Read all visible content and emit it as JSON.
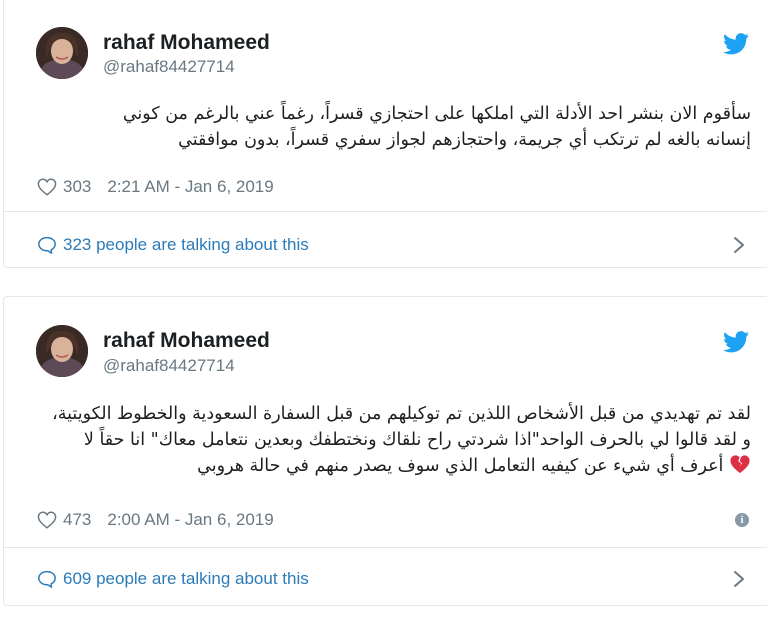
{
  "tweets": [
    {
      "user": {
        "name": "rahaf Mohameed",
        "handle": "@rahaf84427714"
      },
      "text_lines": [
        "سأقوم الان بنشر احد الأدلة التي املكها على احتجازي قسراً، رغماً عني بالرغم من كوني",
        "إنسانه بالغه لم ترتكب أي جريمة، واحتجازهم لجواز سفري قسراً، بدون موافقتي"
      ],
      "likes": "303",
      "timestamp": "2:21 AM - Jan 6, 2019",
      "talking": "323 people are talking about this"
    },
    {
      "user": {
        "name": "rahaf Mohameed",
        "handle": "@rahaf84427714"
      },
      "text_lines": [
        "لقد تم تهديدي من قبل الأشخاص اللذين تم توكيلهم من قبل السفارة السعودية والخطوط الكويتية،",
        "و لقد قالوا لي بالحرف الواحد\"اذا شردتي راح نلقاك ونختطفك وبعدين نتعامل معاك\" انا حقاً لا",
        "أعرف أي شيء عن كيفيه التعامل الذي سوف يصدر منهم في حالة هروبي"
      ],
      "likes": "473",
      "timestamp": "2:00 AM - Jan 6, 2019",
      "talking": "609 people are talking about this"
    }
  ],
  "icons": {
    "twitter": "twitter-bird-icon",
    "like": "heart-outline-icon",
    "reply": "speech-bubble-icon",
    "more": "chevron-right-icon",
    "info": "info-icon",
    "emoji": "broken-heart-icon"
  },
  "colors": {
    "twitter_blue": "#1da1f2",
    "link_blue": "#2b7bb9",
    "muted": "#697882",
    "border": "#e1e8ed",
    "broken_heart": "#dd2e44"
  }
}
